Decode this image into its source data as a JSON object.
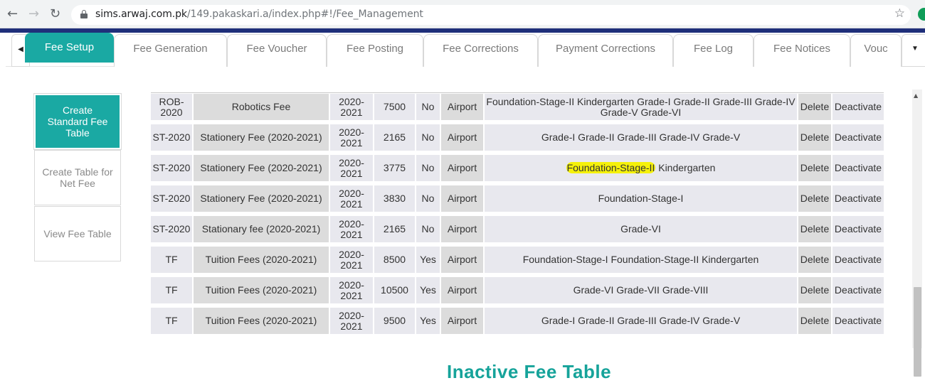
{
  "browser": {
    "url_host": "sims.arwaj.com.pk",
    "url_path": "/149.pakaskari.a/index.php#!/Fee_Management"
  },
  "tabs": [
    {
      "label": "Fee Setup",
      "active": true
    },
    {
      "label": "Fee Generation",
      "active": false
    },
    {
      "label": "Fee Voucher",
      "active": false
    },
    {
      "label": "Fee Posting",
      "active": false
    },
    {
      "label": "Fee Corrections",
      "active": false
    },
    {
      "label": "Payment Corrections",
      "active": false
    },
    {
      "label": "Fee Log",
      "active": false
    },
    {
      "label": "Fee Notices",
      "active": false
    },
    {
      "label": "Vouc",
      "active": false
    }
  ],
  "leftnav": [
    {
      "label": "Create Standard Fee Table",
      "active": true
    },
    {
      "label": "Create Table for Net Fee",
      "active": false
    },
    {
      "label": "View Fee Table",
      "active": false
    }
  ],
  "fee_rows": [
    {
      "code": "ROB-2020",
      "name": "Robotics Fee",
      "session": "2020-2021",
      "amount": "7500",
      "flag": "No",
      "campus": "Airport",
      "grades": "Foundation-Stage-II Kindergarten Grade-I Grade-II Grade-III Grade-IV Grade-V Grade-VI",
      "delete": "Delete",
      "deactivate": "Deactivate"
    },
    {
      "code": "ST-2020",
      "name": "Stationery Fee (2020-2021)",
      "session": "2020-2021",
      "amount": "2165",
      "flag": "No",
      "campus": "Airport",
      "grades": "Grade-I Grade-II Grade-III Grade-IV Grade-V",
      "delete": "Delete",
      "deactivate": "Deactivate"
    },
    {
      "code": "ST-2020",
      "name": "Stationery Fee (2020-2021)",
      "session": "2020-2021",
      "amount": "3775",
      "flag": "No",
      "campus": "Airport",
      "grades_highlight": "Foundation-Stage-II",
      "grades_rest": " Kindergarten",
      "delete": "Delete",
      "deactivate": "Deactivate"
    },
    {
      "code": "ST-2020",
      "name": "Stationery Fee (2020-2021)",
      "session": "2020-2021",
      "amount": "3830",
      "flag": "No",
      "campus": "Airport",
      "grades": "Foundation-Stage-I",
      "delete": "Delete",
      "deactivate": "Deactivate"
    },
    {
      "code": "ST-2020",
      "name": "Stationary fee (2020-2021)",
      "session": "2020-2021",
      "amount": "2165",
      "flag": "No",
      "campus": "Airport",
      "grades": "Grade-VI",
      "delete": "Delete",
      "deactivate": "Deactivate"
    },
    {
      "code": "TF",
      "name": "Tuition Fees (2020-2021)",
      "session": "2020-2021",
      "amount": "8500",
      "flag": "Yes",
      "campus": "Airport",
      "grades": "Foundation-Stage-I Foundation-Stage-II Kindergarten",
      "delete": "Delete",
      "deactivate": "Deactivate"
    },
    {
      "code": "TF",
      "name": "Tuition Fees (2020-2021)",
      "session": "2020-2021",
      "amount": "10500",
      "flag": "Yes",
      "campus": "Airport",
      "grades": "Grade-VI Grade-VII Grade-VIII",
      "delete": "Delete",
      "deactivate": "Deactivate"
    },
    {
      "code": "TF",
      "name": "Tuition Fees (2020-2021)",
      "session": "2020-2021",
      "amount": "9500",
      "flag": "Yes",
      "campus": "Airport",
      "grades": "Grade-I Grade-II Grade-III Grade-IV Grade-V",
      "delete": "Delete",
      "deactivate": "Deactivate"
    }
  ],
  "section_title": "Inactive Fee Table",
  "colors": {
    "accent": "#1aa9a3",
    "header_bar": "#1f2f7a",
    "highlight": "#f5f10a"
  },
  "icons": {
    "back": "back-arrow-icon",
    "forward": "forward-arrow-icon",
    "reload": "reload-icon",
    "lock": "lock-icon",
    "star": "star-icon"
  }
}
